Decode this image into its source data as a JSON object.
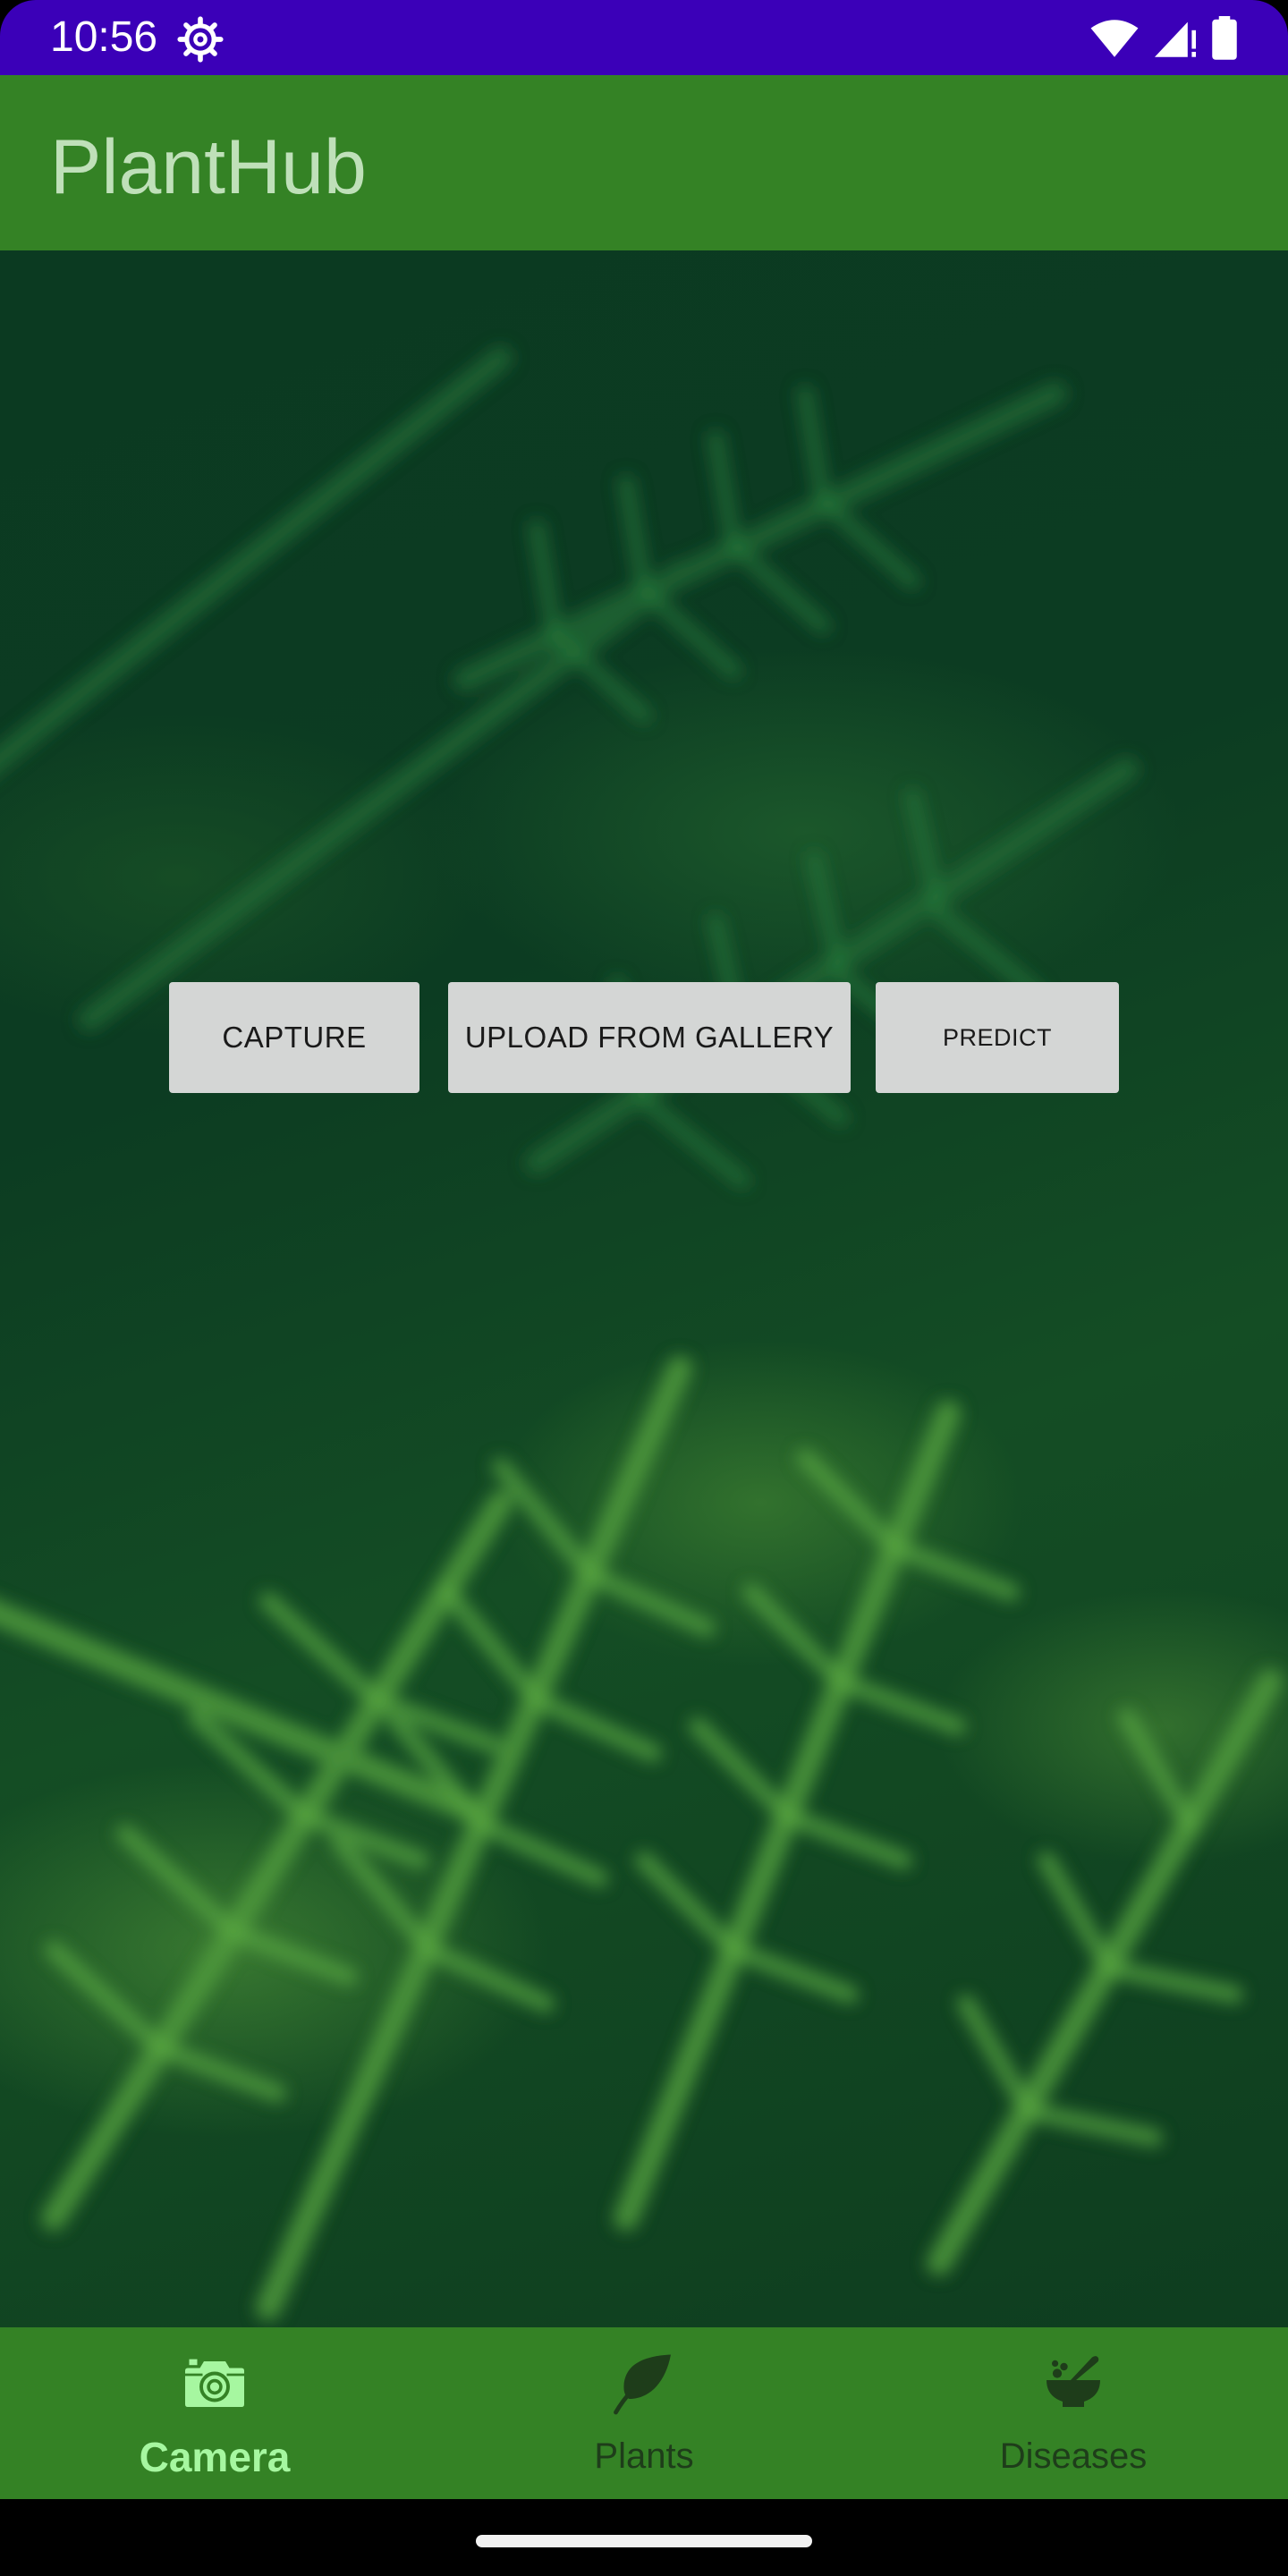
{
  "status_bar": {
    "time": "10:56",
    "icons": [
      "settings-gear-icon",
      "wifi-icon",
      "cell-signal-icon",
      "battery-icon"
    ],
    "color": "#3b00b8"
  },
  "app_bar": {
    "title": "PlantHub",
    "color": "#348225"
  },
  "actions": {
    "capture_label": "CAPTURE",
    "upload_label": "UPLOAD FROM GALLERY",
    "predict_label": "PREDICT"
  },
  "bottom_nav": {
    "items": [
      {
        "label": "Camera",
        "icon": "camera-icon",
        "selected": true
      },
      {
        "label": "Plants",
        "icon": "leaf-icon",
        "selected": false
      },
      {
        "label": "Diseases",
        "icon": "mortar-pestle-icon",
        "selected": false
      }
    ],
    "color": "#348225",
    "selected_color": "#a6f7a0"
  },
  "background_image": "fern-leaves"
}
